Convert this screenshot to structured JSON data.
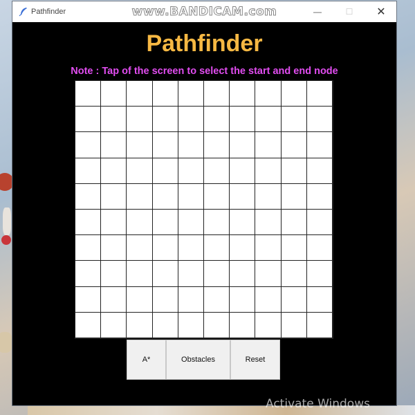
{
  "window": {
    "title": "Pathfinder",
    "minimize_glyph": "—",
    "maximize_glyph": "☐",
    "close_glyph": "✕",
    "app_icon": "feather-icon"
  },
  "watermark": "www.BANDICAM.com",
  "app": {
    "title": "Pathfinder",
    "note": "Note : Tap of the screen to select the start and end node",
    "title_color": "#f6b843",
    "note_color": "#e14df0",
    "background": "#000000"
  },
  "grid": {
    "rows": 10,
    "cols": 10
  },
  "buttons": {
    "astar": "A*",
    "obstacles": "Obstacles",
    "reset": "Reset"
  },
  "desktop": {
    "activate_text": "Activate Windows"
  }
}
